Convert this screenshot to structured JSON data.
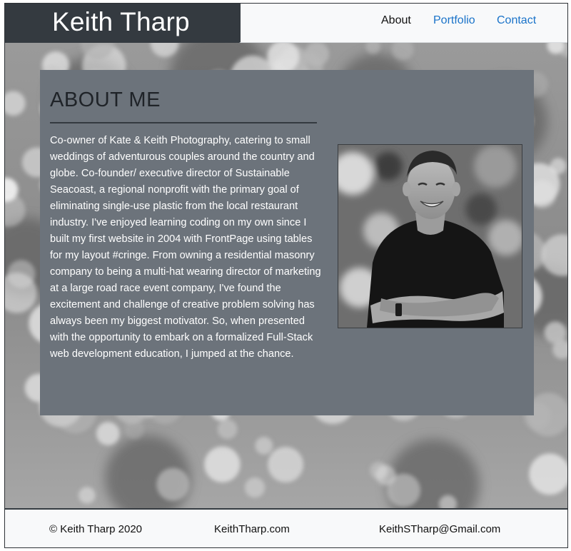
{
  "header": {
    "brand": "Keith Tharp",
    "nav": [
      {
        "label": "About"
      },
      {
        "label": "Portfolio"
      },
      {
        "label": "Contact"
      }
    ]
  },
  "about": {
    "title": "ABOUT ME",
    "body": "Co-owner of Kate & Keith Photography, catering to small weddings of adventurous couples around the country and globe. Co-founder/ executive director of Sustainable Seacoast, a regional nonprofit with the primary goal of eliminating single-use plastic from the local restaurant industry. I've enjoyed learning coding on my own since I built my first website in 2004 with FrontPage using tables for my layout #cringe. From owning a residential masonry company to being a multi-hat wearing director of marketing at a large road race event company, I've found the excitement and challenge of creative problem solving has always been my biggest motivator. So, when presented with the opportunity to embark on a formalized Full-Stack web development education, I jumped at the chance."
  },
  "footer": {
    "copyright": "© Keith Tharp 2020",
    "website": "KeithTharp.com",
    "email": "KeithSTharp@Gmail.com"
  },
  "colors": {
    "header_dark": "#343a40",
    "nav_link": "#1a73c9",
    "card_bg": "#6c737b"
  }
}
